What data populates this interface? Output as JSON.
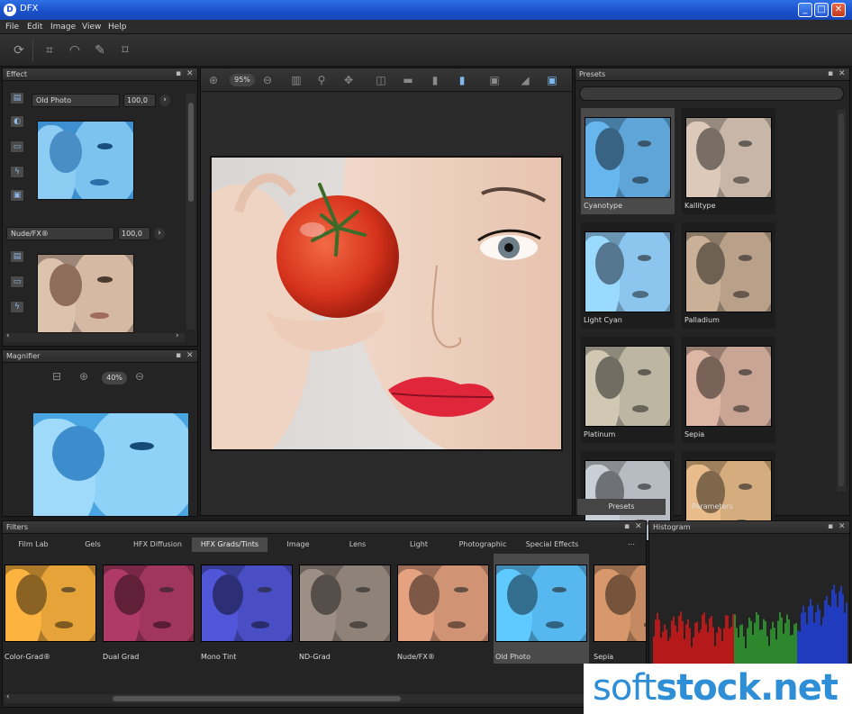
{
  "window": {
    "title": "DFX",
    "app_icon": "dfx-logo-icon"
  },
  "menu": [
    "File",
    "Edit",
    "Image",
    "View",
    "Help"
  ],
  "effect_panel": {
    "title": "Effect",
    "effects": [
      {
        "name": "Old Photo",
        "value": "100,0"
      },
      {
        "name": "Nude/FX®",
        "value": "100,0"
      }
    ]
  },
  "magnifier_panel": {
    "title": "Magnifier",
    "zoom": "40%"
  },
  "canvas": {
    "zoom": "95%"
  },
  "presets_panel": {
    "title": "Presets",
    "search_placeholder": "",
    "items": [
      {
        "name": "Cyanotype",
        "tint": "#5fa5d8"
      },
      {
        "name": "Kallitype",
        "tint": "#c8b7a8"
      },
      {
        "name": "Light Cyan",
        "tint": "#8cc6ee"
      },
      {
        "name": "Palladium",
        "tint": "#b8a089"
      },
      {
        "name": "Platinum",
        "tint": "#bdb6a3"
      },
      {
        "name": "Sepia",
        "tint": "#c9a595"
      },
      {
        "name": "",
        "tint": "#b7bcc3"
      },
      {
        "name": "",
        "tint": "#d4ac7e"
      }
    ],
    "tabs": [
      "Presets",
      "Parameters"
    ]
  },
  "filters_panel": {
    "title": "Filters",
    "tabs": [
      "Film Lab",
      "Gels",
      "HFX Diffusion",
      "HFX Grads/Tints",
      "Image",
      "Lens",
      "Light",
      "Photographic",
      "Special Effects"
    ],
    "active_tab": "HFX Grads/Tints",
    "items": [
      {
        "name": "Color-Grad®",
        "tint": "#e6a33a"
      },
      {
        "name": "Dual Grad",
        "tint": "#a0355e"
      },
      {
        "name": "Mono Tint",
        "tint": "#4a4ec4"
      },
      {
        "name": "ND-Grad",
        "tint": "#8f8279"
      },
      {
        "name": "Nude/FX®",
        "tint": "#d09374"
      },
      {
        "name": "Old Photo",
        "tint": "#56b8ee"
      },
      {
        "name": "Sepia",
        "tint": "#c58a62"
      }
    ]
  },
  "histogram_panel": {
    "title": "Histogram"
  },
  "watermark": {
    "prefix": "soft",
    "suffix": "stock.net"
  }
}
